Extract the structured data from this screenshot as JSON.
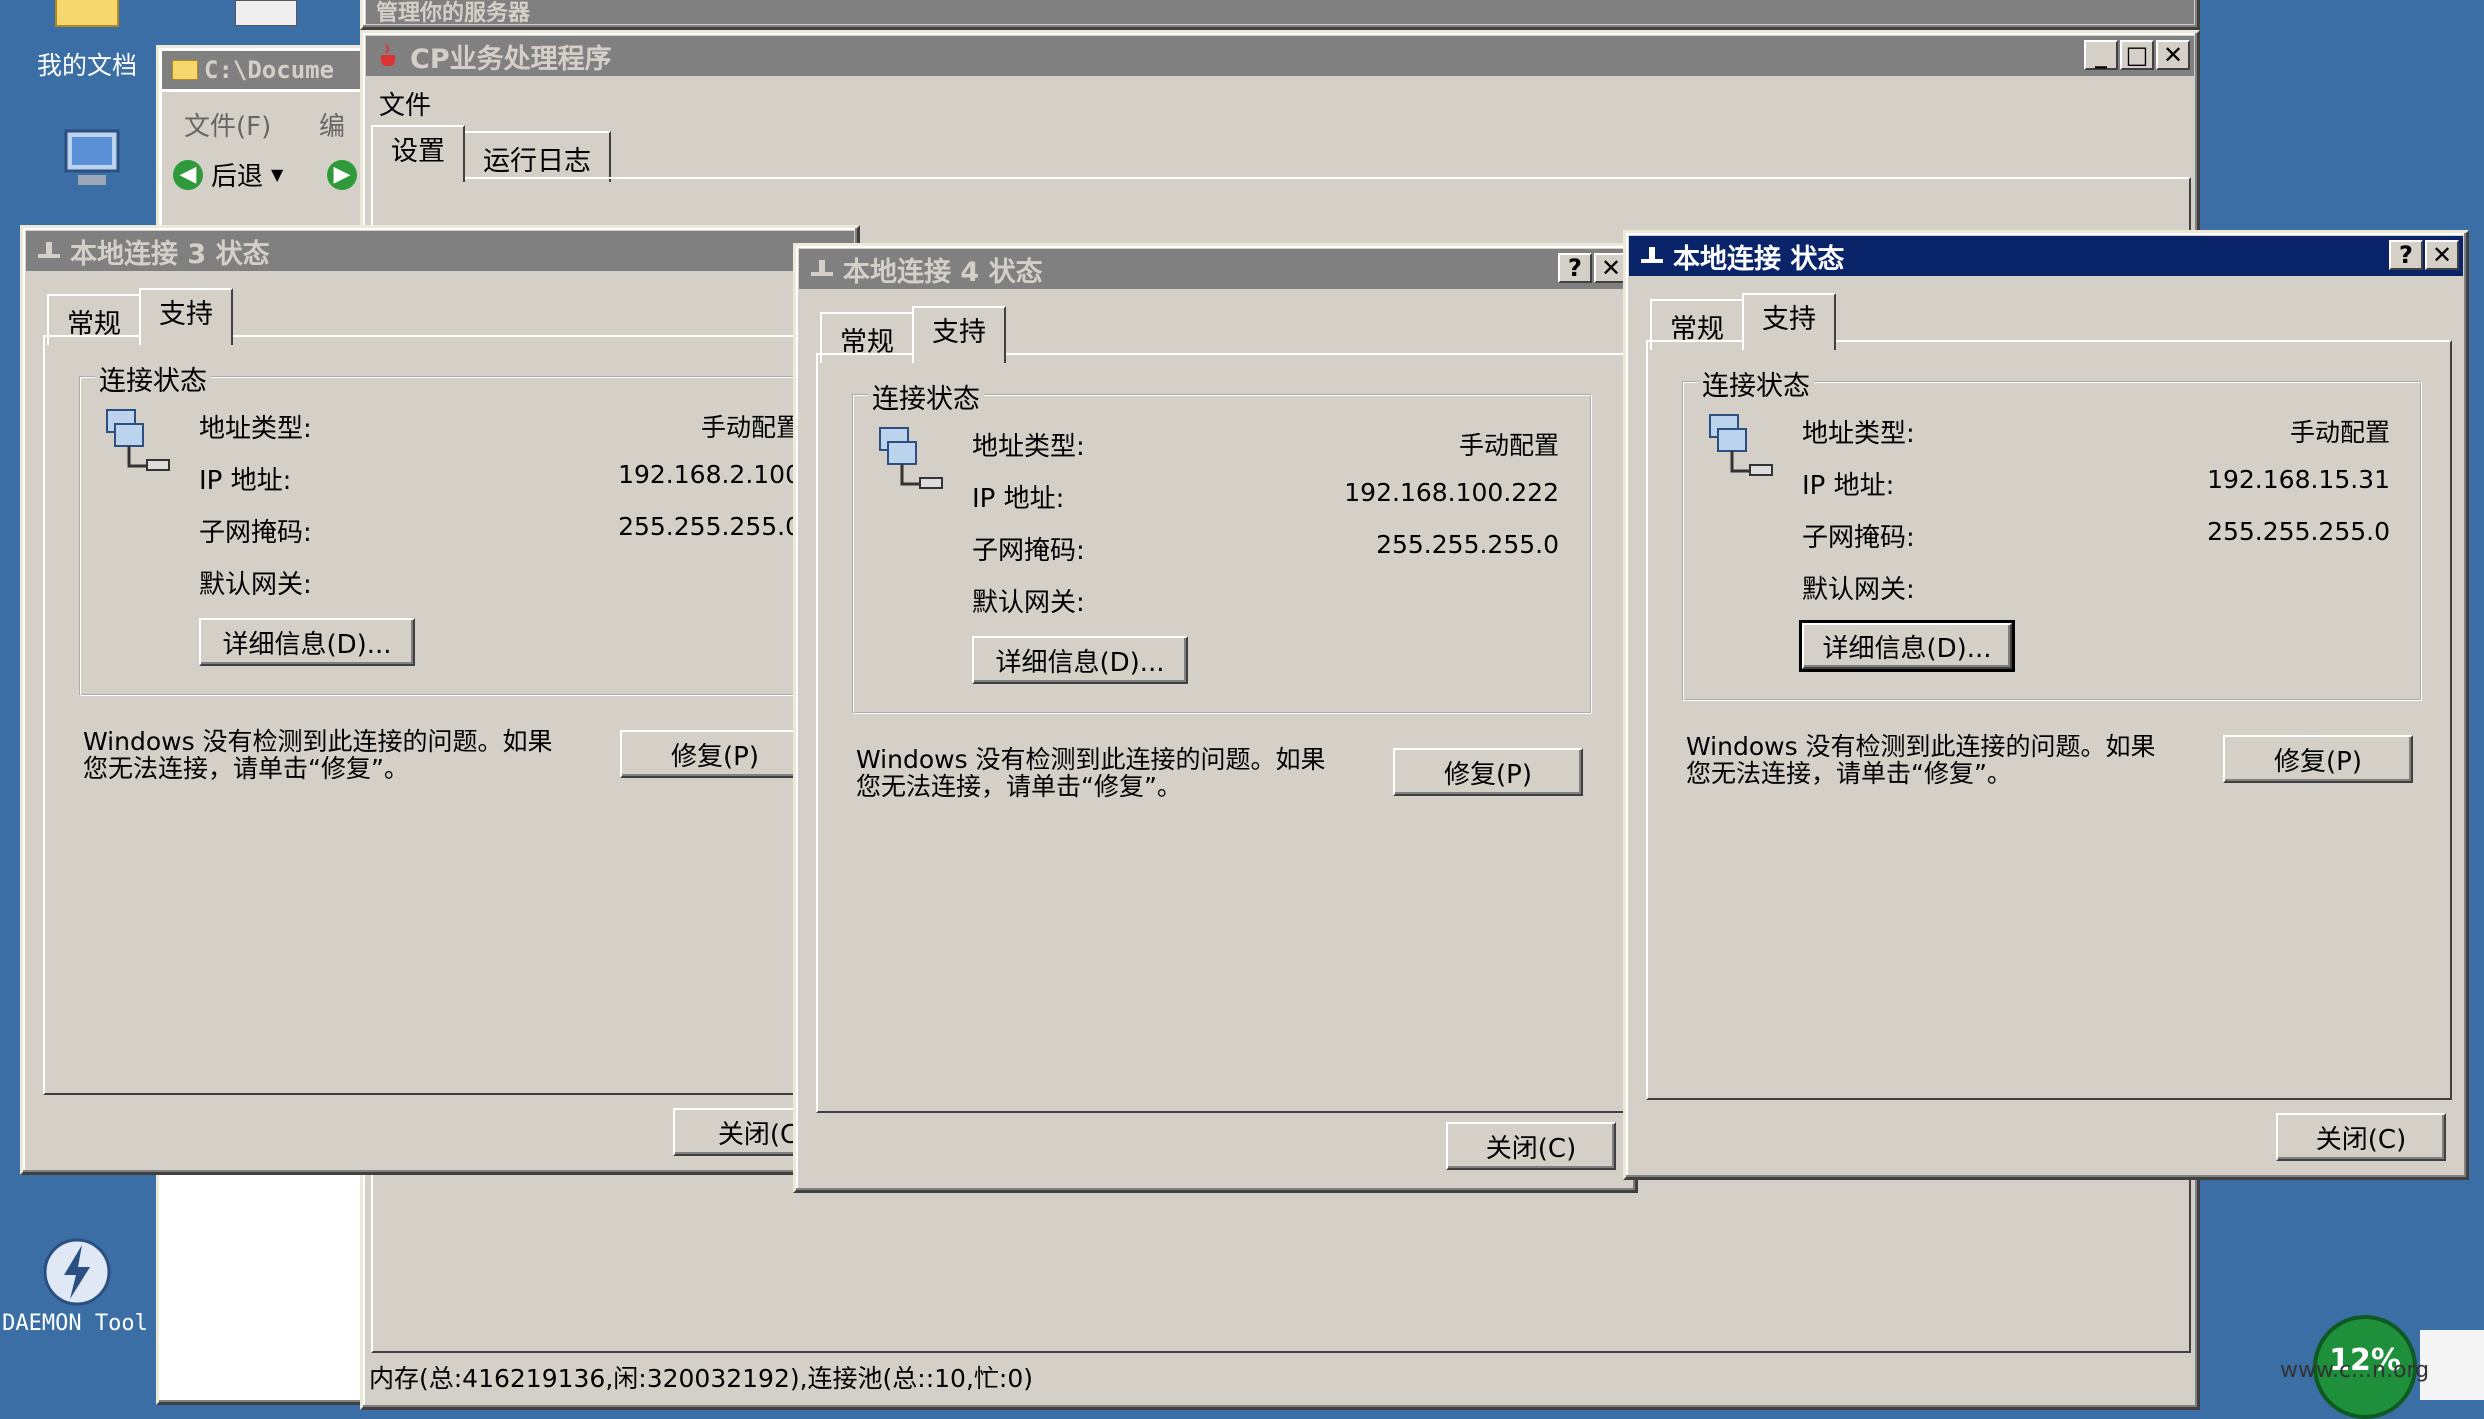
{
  "desktop": {
    "icons": [
      {
        "label": "我的文档",
        "icon": "folder-icon"
      },
      {
        "label": "DAEMON Tool",
        "icon": "lightning-icon"
      }
    ]
  },
  "bg_windows": {
    "server_manager_title": "管理你的服务器",
    "explorer": {
      "title": "C:\\Docume",
      "menu_file": "文件(F)",
      "menu_edit": "编",
      "back": "后退"
    }
  },
  "cp_app": {
    "title": "CP业务处理程序",
    "menu_file": "文件",
    "tabs": [
      "设置",
      "运行日志"
    ],
    "status": "内存(总:416219136,闲:320032192),连接池(总::10,忙:0)"
  },
  "dialogs": [
    {
      "title": "本地连接 3 状态",
      "tabs": [
        "常规",
        "支持"
      ],
      "group_label": "连接状态",
      "addr_type_label": "地址类型:",
      "addr_type_value": "手动配置",
      "ip_label": "IP 地址:",
      "ip_value": "192.168.2.100",
      "mask_label": "子网掩码:",
      "mask_value": "255.255.255.0",
      "gw_label": "默认网关:",
      "details_button": "详细信息(D)...",
      "message": "Windows 没有检测到此连接的问题。如果\n您无法连接，请单击“修复”。",
      "repair_button": "修复(P)",
      "close_button": "关闭(C"
    },
    {
      "title": "本地连接 4 状态",
      "tabs": [
        "常规",
        "支持"
      ],
      "group_label": "连接状态",
      "addr_type_label": "地址类型:",
      "addr_type_value": "手动配置",
      "ip_label": "IP 地址:",
      "ip_value": "192.168.100.222",
      "mask_label": "子网掩码:",
      "mask_value": "255.255.255.0",
      "gw_label": "默认网关:",
      "details_button": "详细信息(D)...",
      "message": "Windows 没有检测到此连接的问题。如果\n您无法连接，请单击“修复”。",
      "repair_button": "修复(P)",
      "close_button": "关闭(C)"
    },
    {
      "title": "本地连接 状态",
      "tabs": [
        "常规",
        "支持"
      ],
      "group_label": "连接状态",
      "addr_type_label": "地址类型:",
      "addr_type_value": "手动配置",
      "ip_label": "IP 地址:",
      "ip_value": "192.168.15.31",
      "mask_label": "子网掩码:",
      "mask_value": "255.255.255.0",
      "gw_label": "默认网关:",
      "details_button": "详细信息(D)...",
      "message": "Windows 没有检测到此连接的问题。如果\n您无法连接，请单击“修复”。",
      "repair_button": "修复(P)",
      "close_button": "关闭(C)"
    }
  ],
  "tray": {
    "percent": "12%",
    "watermark": "www.c...n.org"
  },
  "colors": {
    "desktop": "#3a6ea5",
    "active_title": "#0a246a",
    "inactive_title": "#808080",
    "face": "#d4d0c8"
  }
}
